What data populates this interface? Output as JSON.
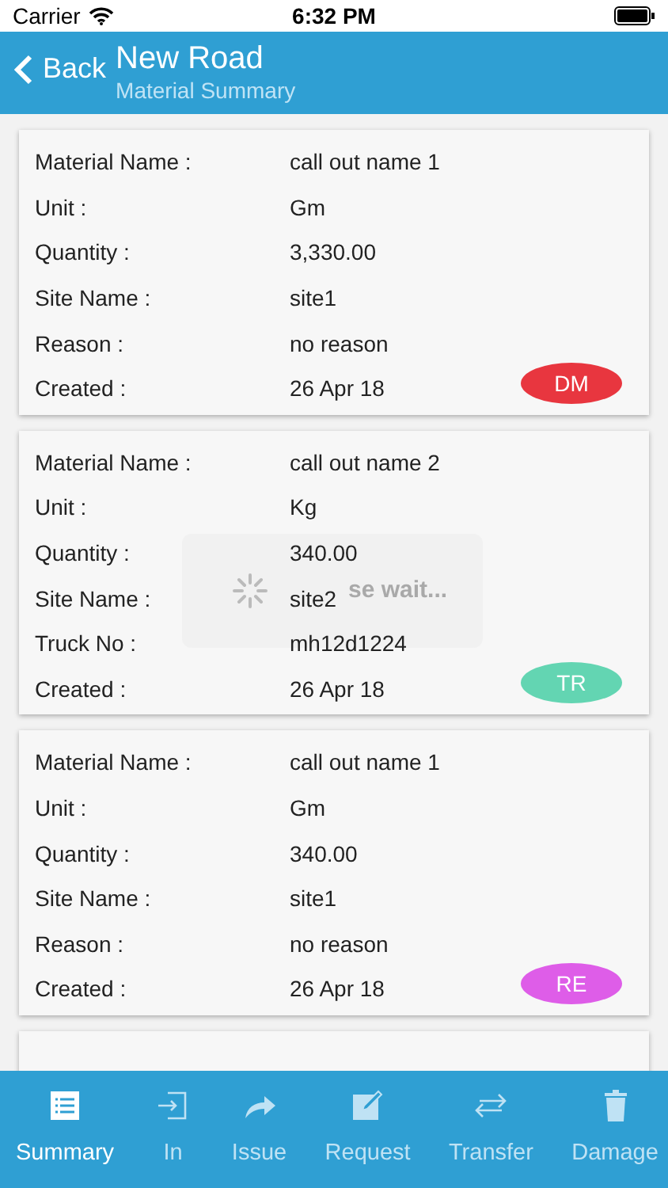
{
  "status_bar": {
    "carrier": "Carrier",
    "time": "6:32 PM"
  },
  "header": {
    "back": "Back",
    "title": "New Road",
    "subtitle": "Material Summary"
  },
  "cards": [
    {
      "rows": [
        {
          "label": "Material Name :",
          "value": "call out name 1"
        },
        {
          "label": "Unit :",
          "value": "Gm"
        },
        {
          "label": "Quantity :",
          "value": "3,330.00"
        },
        {
          "label": "Site Name :",
          "value": "site1"
        },
        {
          "label": "Reason :",
          "value": "no reason"
        },
        {
          "label": "Created :",
          "value": "26 Apr 18"
        }
      ],
      "badge": {
        "text": "DM",
        "color": "#e8363f"
      }
    },
    {
      "rows": [
        {
          "label": "Material Name :",
          "value": "call out name 2"
        },
        {
          "label": "Unit :",
          "value": "Kg"
        },
        {
          "label": "Quantity :",
          "value": "340.00"
        },
        {
          "label": "Site Name :",
          "value": "site2"
        },
        {
          "label": "Truck No :",
          "value": "mh12d1224"
        },
        {
          "label": "Created :",
          "value": "26 Apr 18"
        }
      ],
      "badge": {
        "text": "TR",
        "color": "#63d5b2"
      }
    },
    {
      "rows": [
        {
          "label": "Material Name :",
          "value": "call out name 1"
        },
        {
          "label": "Unit :",
          "value": "Gm"
        },
        {
          "label": "Quantity :",
          "value": "340.00"
        },
        {
          "label": "Site Name :",
          "value": "site1"
        },
        {
          "label": "Reason :",
          "value": "no reason"
        },
        {
          "label": "Created :",
          "value": "26 Apr 18"
        }
      ],
      "badge": {
        "text": "RE",
        "color": "#de5de8"
      }
    }
  ],
  "loading": {
    "text": "se wait..."
  },
  "tabs": [
    {
      "label": "Summary",
      "selected": true
    },
    {
      "label": "In",
      "selected": false
    },
    {
      "label": "Issue",
      "selected": false
    },
    {
      "label": "Request",
      "selected": false
    },
    {
      "label": "Transfer",
      "selected": false
    },
    {
      "label": "Damage",
      "selected": false
    }
  ]
}
